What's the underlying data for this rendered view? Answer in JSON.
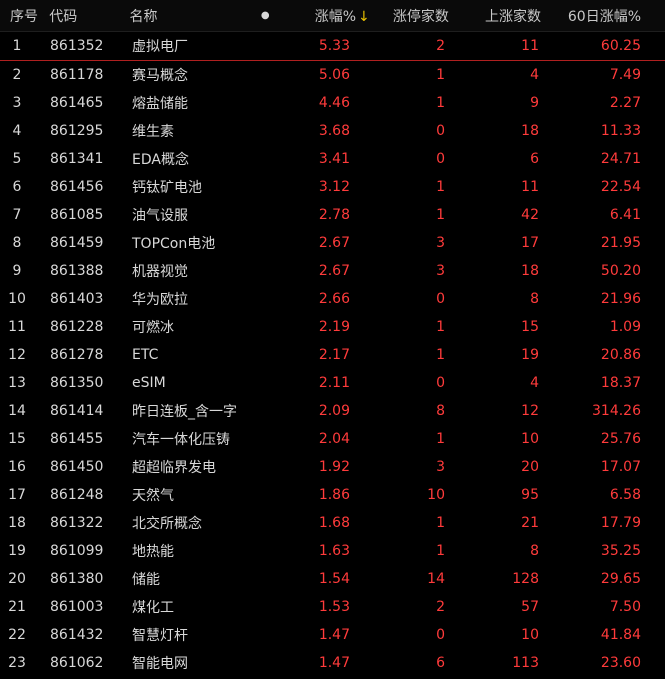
{
  "header": {
    "idx": "序号",
    "code": "代码",
    "name": "名称",
    "dot": "●",
    "chg": "涨幅%",
    "sort_arrow": "↓",
    "limit_up": "涨停家数",
    "up_count": "上涨家数",
    "chg60": "60日涨幅%"
  },
  "colors": {
    "up": "#ff3b3b",
    "sort_arrow": "#e8c000",
    "selected_line": "#b02020"
  },
  "rows": [
    {
      "idx": "1",
      "code": "861352",
      "name": "虚拟电厂",
      "chg": "5.33",
      "limit_up": "2",
      "up_count": "11",
      "chg60": "60.25"
    },
    {
      "idx": "2",
      "code": "861178",
      "name": "赛马概念",
      "chg": "5.06",
      "limit_up": "1",
      "up_count": "4",
      "chg60": "7.49"
    },
    {
      "idx": "3",
      "code": "861465",
      "name": "熔盐储能",
      "chg": "4.46",
      "limit_up": "1",
      "up_count": "9",
      "chg60": "2.27"
    },
    {
      "idx": "4",
      "code": "861295",
      "name": "维生素",
      "chg": "3.68",
      "limit_up": "0",
      "up_count": "18",
      "chg60": "11.33"
    },
    {
      "idx": "5",
      "code": "861341",
      "name": "EDA概念",
      "chg": "3.41",
      "limit_up": "0",
      "up_count": "6",
      "chg60": "24.71"
    },
    {
      "idx": "6",
      "code": "861456",
      "name": "钙钛矿电池",
      "chg": "3.12",
      "limit_up": "1",
      "up_count": "11",
      "chg60": "22.54"
    },
    {
      "idx": "7",
      "code": "861085",
      "name": "油气设服",
      "chg": "2.78",
      "limit_up": "1",
      "up_count": "42",
      "chg60": "6.41"
    },
    {
      "idx": "8",
      "code": "861459",
      "name": "TOPCon电池",
      "chg": "2.67",
      "limit_up": "3",
      "up_count": "17",
      "chg60": "21.95"
    },
    {
      "idx": "9",
      "code": "861388",
      "name": "机器视觉",
      "chg": "2.67",
      "limit_up": "3",
      "up_count": "18",
      "chg60": "50.20"
    },
    {
      "idx": "10",
      "code": "861403",
      "name": "华为欧拉",
      "chg": "2.66",
      "limit_up": "0",
      "up_count": "8",
      "chg60": "21.96"
    },
    {
      "idx": "11",
      "code": "861228",
      "name": "可燃冰",
      "chg": "2.19",
      "limit_up": "1",
      "up_count": "15",
      "chg60": "1.09"
    },
    {
      "idx": "12",
      "code": "861278",
      "name": "ETC",
      "chg": "2.17",
      "limit_up": "1",
      "up_count": "19",
      "chg60": "20.86"
    },
    {
      "idx": "13",
      "code": "861350",
      "name": "eSIM",
      "chg": "2.11",
      "limit_up": "0",
      "up_count": "4",
      "chg60": "18.37"
    },
    {
      "idx": "14",
      "code": "861414",
      "name": "昨日连板_含一字",
      "chg": "2.09",
      "limit_up": "8",
      "up_count": "12",
      "chg60": "314.26"
    },
    {
      "idx": "15",
      "code": "861455",
      "name": "汽车一体化压铸",
      "chg": "2.04",
      "limit_up": "1",
      "up_count": "10",
      "chg60": "25.76"
    },
    {
      "idx": "16",
      "code": "861450",
      "name": "超超临界发电",
      "chg": "1.92",
      "limit_up": "3",
      "up_count": "20",
      "chg60": "17.07"
    },
    {
      "idx": "17",
      "code": "861248",
      "name": "天然气",
      "chg": "1.86",
      "limit_up": "10",
      "up_count": "95",
      "chg60": "6.58"
    },
    {
      "idx": "18",
      "code": "861322",
      "name": "北交所概念",
      "chg": "1.68",
      "limit_up": "1",
      "up_count": "21",
      "chg60": "17.79"
    },
    {
      "idx": "19",
      "code": "861099",
      "name": "地热能",
      "chg": "1.63",
      "limit_up": "1",
      "up_count": "8",
      "chg60": "35.25"
    },
    {
      "idx": "20",
      "code": "861380",
      "name": "储能",
      "chg": "1.54",
      "limit_up": "14",
      "up_count": "128",
      "chg60": "29.65"
    },
    {
      "idx": "21",
      "code": "861003",
      "name": "煤化工",
      "chg": "1.53",
      "limit_up": "2",
      "up_count": "57",
      "chg60": "7.50"
    },
    {
      "idx": "22",
      "code": "861432",
      "name": "智慧灯杆",
      "chg": "1.47",
      "limit_up": "0",
      "up_count": "10",
      "chg60": "41.84"
    },
    {
      "idx": "23",
      "code": "861062",
      "name": "智能电网",
      "chg": "1.47",
      "limit_up": "6",
      "up_count": "113",
      "chg60": "23.60"
    }
  ]
}
